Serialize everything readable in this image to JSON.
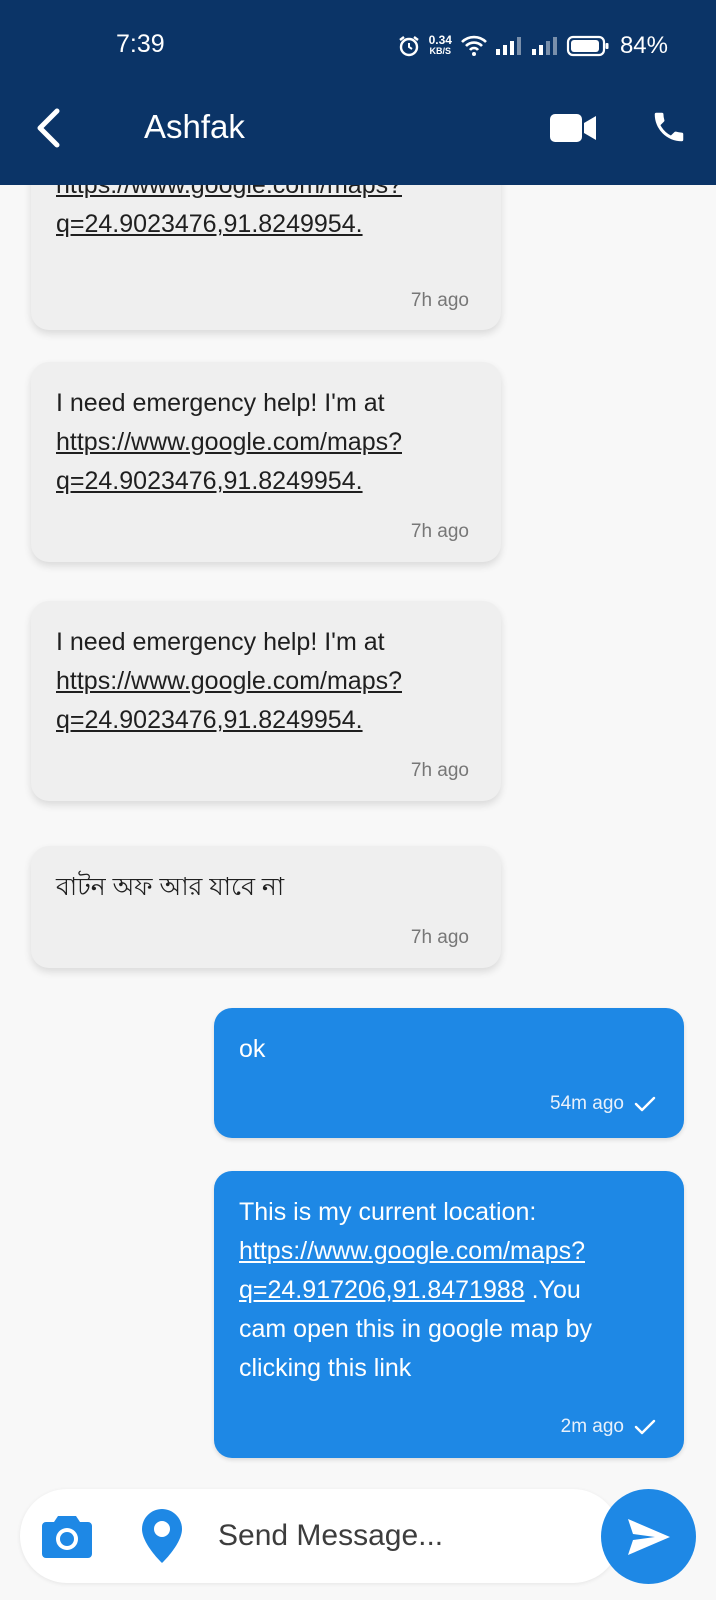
{
  "status_bar": {
    "time": "7:39",
    "net_speed_value": "0.34",
    "net_speed_unit": "KB/S",
    "battery": "84%",
    "icons": [
      "alarm-icon",
      "wifi-icon",
      "signal-icon",
      "signal-icon",
      "battery-icon"
    ]
  },
  "header": {
    "contact_name": "Ashfak",
    "icons": [
      "back-icon",
      "video-camera-icon",
      "phone-icon"
    ],
    "background": "#0b3467"
  },
  "messages": [
    {
      "direction": "incoming",
      "lines": [
        "https://www.google.com/maps?",
        "q=24.9023476,91.8249954."
      ],
      "time": "7h ago"
    },
    {
      "direction": "incoming",
      "text": "I need emergency help! I'm at",
      "lines": [
        "https://www.google.com/maps?",
        "q=24.9023476,91.8249954."
      ],
      "time": "7h ago"
    },
    {
      "direction": "incoming",
      "text": "I need emergency help! I'm at",
      "lines": [
        "https://www.google.com/maps?",
        "q=24.9023476,91.8249954."
      ],
      "time": "7h ago"
    },
    {
      "direction": "incoming",
      "text": "বাটন অফ আর যাবে না",
      "time": "7h ago"
    },
    {
      "direction": "outgoing",
      "text": "ok",
      "time": "54m ago"
    },
    {
      "direction": "outgoing",
      "text": "This is my current location:",
      "link_1": "https://www.google.com/maps?",
      "link_2": "q=24.917206,91.8471988",
      "after_link": " .You",
      "line_4": "cam open this in google map by",
      "line_5": "clicking this link",
      "time": "2m ago"
    }
  ],
  "composer": {
    "placeholder": "Send Message...",
    "icons": [
      "camera-icon",
      "location-pin-icon",
      "send-icon"
    ]
  },
  "colors": {
    "accent": "#1e88e5",
    "incoming_bubble": "#efefef",
    "background": "#f8f8f8"
  }
}
